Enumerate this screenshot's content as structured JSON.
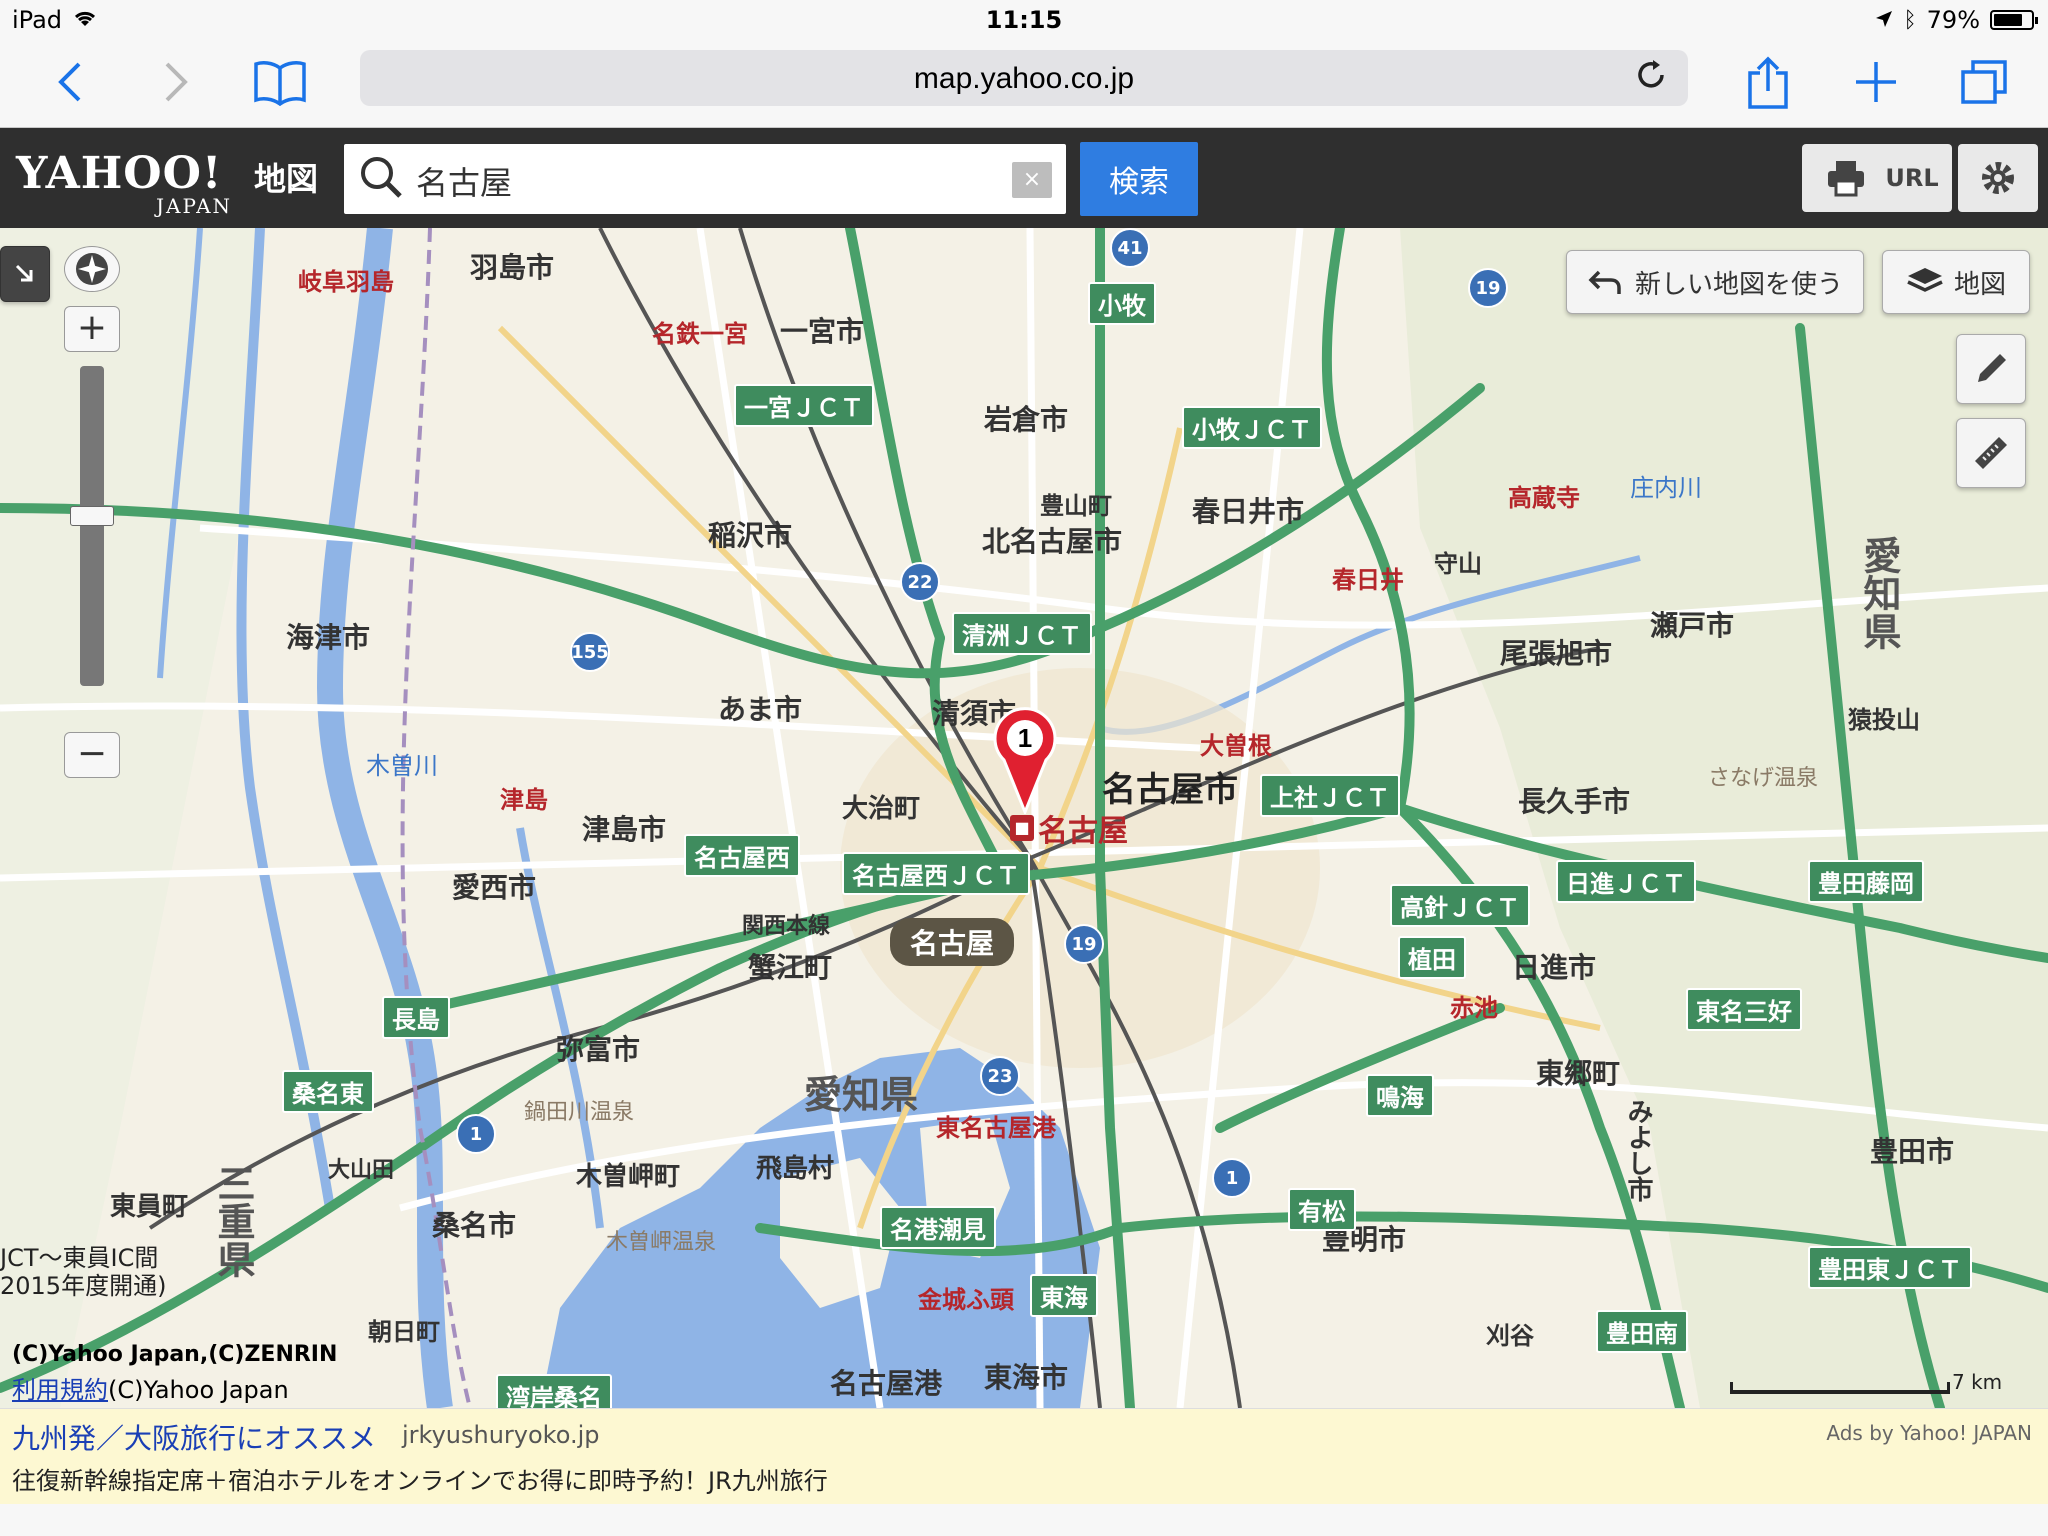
{
  "status": {
    "device": "iPad",
    "time": "11:15",
    "battery": "79%",
    "battery_level": 0.79
  },
  "browser": {
    "url": "map.yahoo.co.jp"
  },
  "header": {
    "logo_main": "YAHOO!",
    "logo_sub": "JAPAN",
    "logo_service": "地図",
    "search_query": "名古屋",
    "clear_label": "×",
    "search_button": "検索",
    "url_button": "URL"
  },
  "map": {
    "new_map_button": "新しい地図を使う",
    "layers_button": "地図",
    "pin_number": "1",
    "station_label": "名古屋",
    "area_badge": "名古屋",
    "copyright": "(C)Yahoo Japan,(C)ZENRIN",
    "terms_link": "利用規約",
    "terms_suffix": "(C)Yahoo Japan",
    "scale": "7 km",
    "note_line1": "JCT～東員IC間",
    "note_line2": "2015年度開通)",
    "labels": {
      "gifu_hashima": "岐阜羽島",
      "hashima_city": "羽島市",
      "ichinomiya_city": "一宮市",
      "meitetsu_ichinomiya": "名鉄一宮",
      "ichinomiya_jct": "一宮ＪＣＴ",
      "inazawa": "稲沢市",
      "iwakura": "岩倉市",
      "komaki": "小牧",
      "komaki_jct": "小牧ＪＣＴ",
      "kasugai_city": "春日井市",
      "kita_nagoya": "北名古屋市",
      "toyoyama": "豊山町",
      "kiyosu_jct": "清洲ＪＣＴ",
      "kiyosu": "清須市",
      "ama": "あま市",
      "tsushima_city": "津島市",
      "tsushima": "津島",
      "oharu": "大治町",
      "nagoya_city": "名古屋市",
      "ozone": "大曽根",
      "kamiyashiro_jct": "上社ＪＣＴ",
      "nagakute": "長久手市",
      "owariasahi": "尾張旭市",
      "seto_city": "瀬戸市",
      "kozoji": "高蔵寺",
      "kaizu": "海津市",
      "aisai": "愛西市",
      "kanie": "蟹江町",
      "yatomi": "弥富市",
      "aichi_pref": "愛知県",
      "nagoya_nishi_jct": "名古屋西ＪＣＴ",
      "kansai_line": "関西本線",
      "nisshin_city": "日進市",
      "nisshin_jct": "日進ＪＣＴ",
      "takabari_jct": "高針ＪＣＴ",
      "akaike": "赤池",
      "togo": "東郷町",
      "miyoshi": "みよし市",
      "toyota_city": "豊田市",
      "toyoake": "豊明市",
      "narumi": "鳴海",
      "higashi_nagoya_port": "東名古屋港",
      "tobishima": "飛島村",
      "kisozaki": "木曽岬町",
      "kuwana_city": "桑名市",
      "toin": "東員町",
      "mie_pref": "三重県",
      "nabana": "鍋田川温泉",
      "kisozaki_onsen": "木曽岬温泉",
      "meiko_shiomi": "名港潮見",
      "kinjo_futo": "金城ふ頭",
      "nagoya_port": "名古屋港",
      "tokai_city": "東海市",
      "asahi_town": "朝日町",
      "wangan_kuwana": "湾岸桑名",
      "kuwana_higashi": "桑名東",
      "nagashima": "長島",
      "oyamada": "大山田",
      "toyota_higashi_jct": "豊田東ＪＣＴ",
      "toyotaminami": "豊田南",
      "kariya": "刈谷",
      "kasugai": "春日井",
      "moriyama": "守山",
      "aichi_seto": "愛知県",
      "sanage_onsen": "さなげ温泉",
      "sanageyama": "猿投山",
      "toyota_fujioka": "豊田藤岡",
      "tomei_miyoshi": "東名三好",
      "kisogawa": "木曽川",
      "yabe_river": "庄内川",
      "ueda": "植田",
      "arimatsu": "有松",
      "tokai": "東海",
      "nagoya_nishi": "名古屋西"
    }
  },
  "ad": {
    "title": "九州発／大阪旅行にオススメ",
    "domain": "jrkyushuryoko.jp",
    "description": "往復新幹線指定席＋宿泊ホテルをオンラインでお得に即時予約！JR九州旅行",
    "ads_by": "Ads by Yahoo! JAPAN"
  },
  "colors": {
    "header_bg": "#2f2f2f",
    "search_button": "#2f7de1",
    "expressway": "#3f8c5e",
    "rail_station": "#b5262b",
    "water": "#8fb4e6",
    "ad_bg": "#fdf8d2"
  }
}
